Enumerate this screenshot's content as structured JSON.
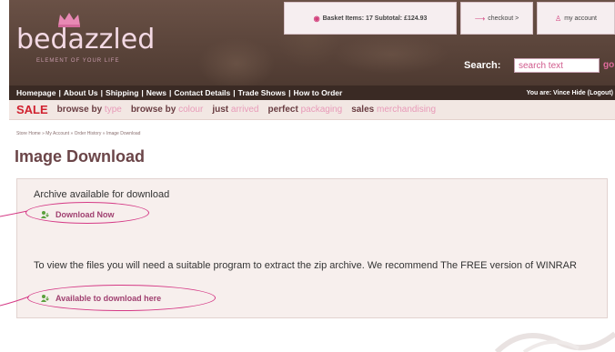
{
  "header": {
    "logo": "bedazzled",
    "tagline": "ELEMENT OF YOUR LIFE",
    "basket": "Basket Items: 17 Subtotal: £124.93",
    "checkout": "checkout >",
    "account": "my account",
    "search_label": "Search:",
    "search_placeholder": "search text",
    "search_go": "go"
  },
  "nav": {
    "items": [
      "Homepage",
      "About Us",
      "Shipping",
      "News",
      "Contact Details",
      "Trade Shows",
      "How to Order"
    ],
    "user": "You are: Vince Hide (Logout)"
  },
  "subnav": {
    "sale": "SALE",
    "items": [
      {
        "prefix": "browse by ",
        "highlight": "type"
      },
      {
        "prefix": "browse by ",
        "highlight": "colour"
      },
      {
        "prefix": "just ",
        "highlight": "arrived"
      },
      {
        "prefix": "perfect ",
        "highlight": "packaging"
      },
      {
        "prefix": "sales ",
        "highlight": "merchandising"
      }
    ]
  },
  "breadcrumb": "Store Home » My Account » Order History » Image Download",
  "page": {
    "title": "Image Download",
    "archive_text": "Archive available for download",
    "download_now": "Download Now",
    "instructions": "To view the files you will need a suitable program to extract the zip archive. We recommend The FREE version of WINRAR",
    "download_here": "Available to download here"
  },
  "colors": {
    "header_bg": "#5a443a",
    "accent_pink": "#d53a86",
    "sale_red": "#d0202e",
    "link": "#a04070"
  },
  "icons": {
    "basket": "basket-icon",
    "checkout": "arrow-icon",
    "account": "person-icon",
    "download": "download-user-icon"
  }
}
